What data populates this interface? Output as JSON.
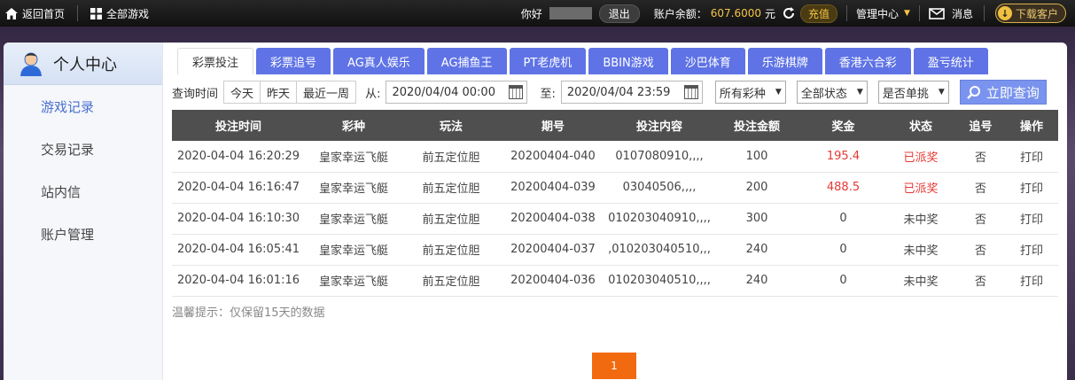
{
  "topbar": {
    "home_label": "返回首页",
    "all_games_label": "全部游戏",
    "hello_label": "你好",
    "logout_label": "退出",
    "balance_label": "账户余额：",
    "balance_value": "607.6000",
    "currency": "元",
    "recharge_label": "充值",
    "manage_label": "管理中心",
    "message_label": "消息",
    "download_label": "下载客户"
  },
  "sidebar": {
    "title": "个人中心",
    "items": [
      {
        "label": "游戏记录"
      },
      {
        "label": "交易记录"
      },
      {
        "label": "站内信"
      },
      {
        "label": "账户管理"
      }
    ]
  },
  "tabs": [
    {
      "label": "彩票投注"
    },
    {
      "label": "彩票追号"
    },
    {
      "label": "AG真人娱乐"
    },
    {
      "label": "AG捕鱼王"
    },
    {
      "label": "PT老虎机"
    },
    {
      "label": "BBIN游戏"
    },
    {
      "label": "沙巴体育"
    },
    {
      "label": "乐游棋牌"
    },
    {
      "label": "香港六合彩"
    },
    {
      "label": "盈亏统计"
    }
  ],
  "filter": {
    "query_time_label": "查询时间",
    "quick": [
      "今天",
      "昨天",
      "最近一周"
    ],
    "from_label": "从:",
    "from_value": "2020/04/04 00:00",
    "to_label": "至:",
    "to_value": "2020/04/04 23:59",
    "lottery_select": "所有彩种",
    "status_select": "全部状态",
    "single_select": "是否单挑",
    "query_button": "立即查询"
  },
  "table": {
    "headers": [
      "投注时间",
      "彩种",
      "玩法",
      "期号",
      "投注内容",
      "投注金额",
      "奖金",
      "状态",
      "追号",
      "操作"
    ],
    "rows": [
      [
        "2020-04-04 16:20:29",
        "皇家幸运飞艇",
        "前五定位胆",
        "20200404-040",
        "0107080910,,,,",
        "100",
        "195.4",
        "已派奖",
        "否",
        "打印"
      ],
      [
        "2020-04-04 16:16:47",
        "皇家幸运飞艇",
        "前五定位胆",
        "20200404-039",
        "03040506,,,,",
        "200",
        "488.5",
        "已派奖",
        "否",
        "打印"
      ],
      [
        "2020-04-04 16:10:30",
        "皇家幸运飞艇",
        "前五定位胆",
        "20200404-038",
        "010203040910,,,,",
        "300",
        "0",
        "未中奖",
        "否",
        "打印"
      ],
      [
        "2020-04-04 16:05:41",
        "皇家幸运飞艇",
        "前五定位胆",
        "20200404-037",
        ",010203040510,,,",
        "240",
        "0",
        "未中奖",
        "否",
        "打印"
      ],
      [
        "2020-04-04 16:01:16",
        "皇家幸运飞艇",
        "前五定位胆",
        "20200404-036",
        "010203040510,,,,",
        "240",
        "0",
        "未中奖",
        "否",
        "打印"
      ]
    ]
  },
  "tip": "温馨提示：仅保留15天的数据",
  "pager": {
    "current": "1"
  },
  "colors": {
    "accent": "#5f73e6",
    "win": "#e53935",
    "gold": "#f5c443",
    "pager": "#f26a10"
  }
}
